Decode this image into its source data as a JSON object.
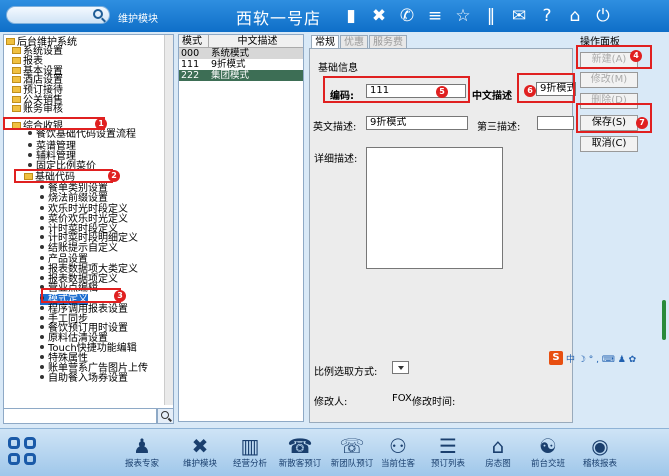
{
  "topbar": {
    "search_placeholder": "",
    "module_label": "维护模块",
    "brand": "西软一号店",
    "icons": [
      "signal-icon",
      "tools-icon",
      "phone-icon",
      "menu-icon",
      "star-icon",
      "pause-icon",
      "mail-icon",
      "help-icon",
      "home-icon",
      "power-icon"
    ]
  },
  "tree": {
    "items": [
      {
        "label": "后台维护系统",
        "kind": "folder"
      },
      {
        "label": "系统设置",
        "kind": "folder"
      },
      {
        "label": "报表",
        "kind": "folder"
      },
      {
        "label": "基本设置",
        "kind": "folder"
      },
      {
        "label": "酒店设置",
        "kind": "folder"
      },
      {
        "label": "预订接待",
        "kind": "folder"
      },
      {
        "label": "公关销售",
        "kind": "folder"
      },
      {
        "label": "账务审核",
        "kind": "folder"
      },
      {
        "label": "综合收银",
        "kind": "folder"
      },
      {
        "label": "餐饮基础代码设置流程",
        "kind": "leaf"
      },
      {
        "label": "菜谱管理",
        "kind": "leaf"
      },
      {
        "label": "辅料管理",
        "kind": "leaf"
      },
      {
        "label": "固定比例菜价",
        "kind": "leaf"
      },
      {
        "label": "基础代码",
        "kind": "folder"
      },
      {
        "label": "餐单类别设置",
        "kind": "leaf"
      },
      {
        "label": "烧法前缀设置",
        "kind": "leaf"
      },
      {
        "label": "欢乐时光时段定义",
        "kind": "leaf"
      },
      {
        "label": "菜价欢乐时光定义",
        "kind": "leaf"
      },
      {
        "label": "计时菜时段定义",
        "kind": "leaf"
      },
      {
        "label": "计时菜时段明细定义",
        "kind": "leaf"
      },
      {
        "label": "结账提示自定义",
        "kind": "leaf"
      },
      {
        "label": "产品设置",
        "kind": "leaf"
      },
      {
        "label": "报表数据项大类定义",
        "kind": "leaf"
      },
      {
        "label": "报表数据项定义",
        "kind": "leaf"
      },
      {
        "label": "营业点编辑",
        "kind": "leaf"
      },
      {
        "label": "模式定义",
        "kind": "leaf"
      },
      {
        "label": "程序调用报表设置",
        "kind": "leaf"
      },
      {
        "label": "手工同步",
        "kind": "leaf"
      },
      {
        "label": "餐饮预订用时设置",
        "kind": "leaf"
      },
      {
        "label": "原料估清设置",
        "kind": "leaf"
      },
      {
        "label": "Touch快捷功能编辑",
        "kind": "leaf"
      },
      {
        "label": "特殊属性",
        "kind": "leaf"
      },
      {
        "label": "账单营系广告图片上传",
        "kind": "leaf"
      },
      {
        "label": "自助餐入场券设置",
        "kind": "leaf"
      }
    ],
    "search_value": ""
  },
  "grid": {
    "headers": [
      "模式",
      "中文描述"
    ],
    "rows": [
      {
        "code": "000",
        "desc": "系统模式"
      },
      {
        "code": "111",
        "desc": "9折模式"
      },
      {
        "code": "222",
        "desc": "集团模式"
      }
    ]
  },
  "tabs": [
    "常规",
    "优惠",
    "服务费"
  ],
  "form": {
    "section_title": "基础信息",
    "code_label": "编码:",
    "code_value": "111",
    "cn_desc_label": "中文描述",
    "cn_desc_value": "9折模式",
    "en_desc_label": "英文描述:",
    "en_desc_value": "9折模式",
    "third_desc_label": "第三描述:",
    "third_desc_value": "",
    "detail_label": "详细描述:",
    "detail_value": "",
    "ratio_label": "比例选取方式:",
    "modifier_label": "修改人:",
    "modifier_value": "FOX",
    "modify_time_label": "修改时间:",
    "modify_time_value": ""
  },
  "ops": {
    "title": "操作面板",
    "new_label": "新建(A)",
    "edit_label": "修改(M)",
    "delete_label": "删除(D)",
    "save_label": "保存(S)",
    "cancel_label": "取消(C)"
  },
  "markers": [
    "1",
    "2",
    "3",
    "4",
    "5",
    "6",
    "7"
  ],
  "ime": {
    "glyphs": "中 ☽ ° , ⌨ ♟ ✿"
  },
  "bottom_nav": [
    {
      "label": "报表专家",
      "icon": "person-icon"
    },
    {
      "label": "维护模块",
      "icon": "tools-icon"
    },
    {
      "label": "经营分析",
      "icon": "bar-chart-icon"
    },
    {
      "label": "新散客预订",
      "icon": "booking-icon"
    },
    {
      "label": "新团队预订",
      "icon": "group-icon"
    },
    {
      "label": "当前住客",
      "icon": "guest-icon"
    },
    {
      "label": "预订列表",
      "icon": "list-icon"
    },
    {
      "label": "房态图",
      "icon": "room-map-icon"
    },
    {
      "label": "前台交班",
      "icon": "handover-icon"
    },
    {
      "label": "稽核报表",
      "icon": "audit-icon"
    }
  ],
  "colors": {
    "accent": "#1a74cc",
    "marker": "#e02020",
    "selected_row": "#3d6e55"
  }
}
